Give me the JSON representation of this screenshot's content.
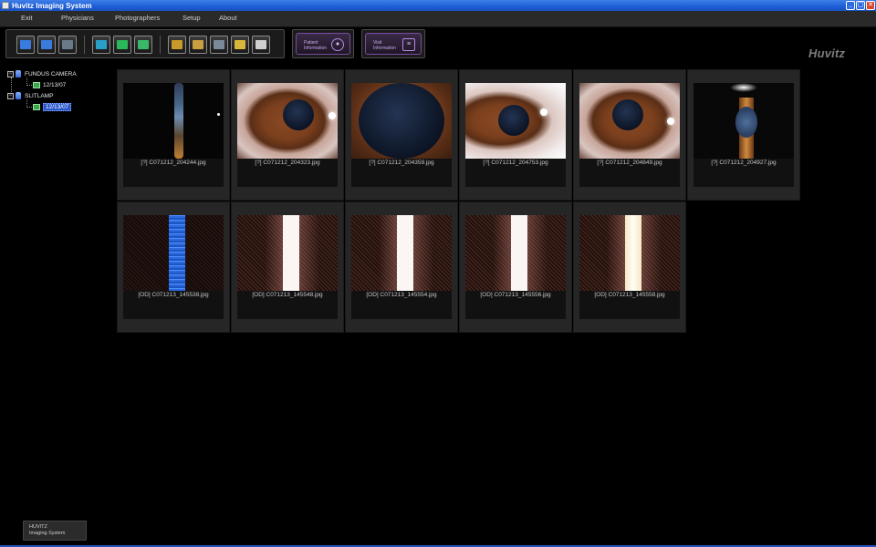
{
  "window": {
    "title": "Huvitz Imaging System",
    "buttons": [
      "_",
      "▢",
      "✕"
    ]
  },
  "menu": [
    "Exit",
    "Physicians",
    "Photographers",
    "Setup",
    "About"
  ],
  "toolbar": {
    "groups": [
      [
        "add-patient",
        "search-patient",
        "camera-capture"
      ],
      [
        "image-view",
        "compare-view",
        "color-view"
      ],
      [
        "import",
        "present",
        "export",
        "folder",
        "print"
      ]
    ],
    "colors": [
      "#3a7be0",
      "#3a7be0",
      "#6a7a8a",
      "#2aa0c8",
      "#2ab85a",
      "#3ab86a",
      "#c89a2a",
      "#c8a040",
      "#7a8a9a",
      "#d8b83a",
      "#d0d0d0"
    ]
  },
  "info_buttons": [
    {
      "label_lines": [
        "Patient",
        "Information"
      ],
      "icon": "person-icon",
      "glyph": "●"
    },
    {
      "label_lines": [
        "Visit",
        "Information"
      ],
      "icon": "clipboard-icon",
      "glyph": "≡"
    }
  ],
  "brand": "Huvitz",
  "tree": {
    "nodes": [
      {
        "label": "FUNDUS CAMERA",
        "expander": "−",
        "children": [
          {
            "label": "12/13/07"
          }
        ]
      },
      {
        "label": "SLITLAMP",
        "expander": "−",
        "children": [
          {
            "label": "12/13/07",
            "selected": true
          }
        ]
      }
    ]
  },
  "thumbnails": [
    {
      "caption": "[?] C071212_204244.jpg",
      "kind": "slit-dark"
    },
    {
      "caption": "[?] C071212_204323.jpg",
      "kind": "eye"
    },
    {
      "caption": "[?] C071212_204359.jpg",
      "kind": "eye-big"
    },
    {
      "caption": "[?] C071212_204753.jpg",
      "kind": "eye-bright"
    },
    {
      "caption": "[?] C071212_204849.jpg",
      "kind": "eye"
    },
    {
      "caption": "[?] C071212_204927.jpg",
      "kind": "slit-side"
    },
    {
      "caption": "[OD] C071213_145538.jpg",
      "kind": "noise-blue"
    },
    {
      "caption": "[OD] C071213_145548.jpg",
      "kind": "noise-warm"
    },
    {
      "caption": "[OD] C071213_145554.jpg",
      "kind": "noise-warm"
    },
    {
      "caption": "[OD] C071213_145556.jpg",
      "kind": "noise-warm"
    },
    {
      "caption": "[OD] C071213_145558.jpg",
      "kind": "noise-warm-gold"
    }
  ],
  "footer": {
    "line1": "HUVITZ",
    "line2": "Imaging System"
  }
}
